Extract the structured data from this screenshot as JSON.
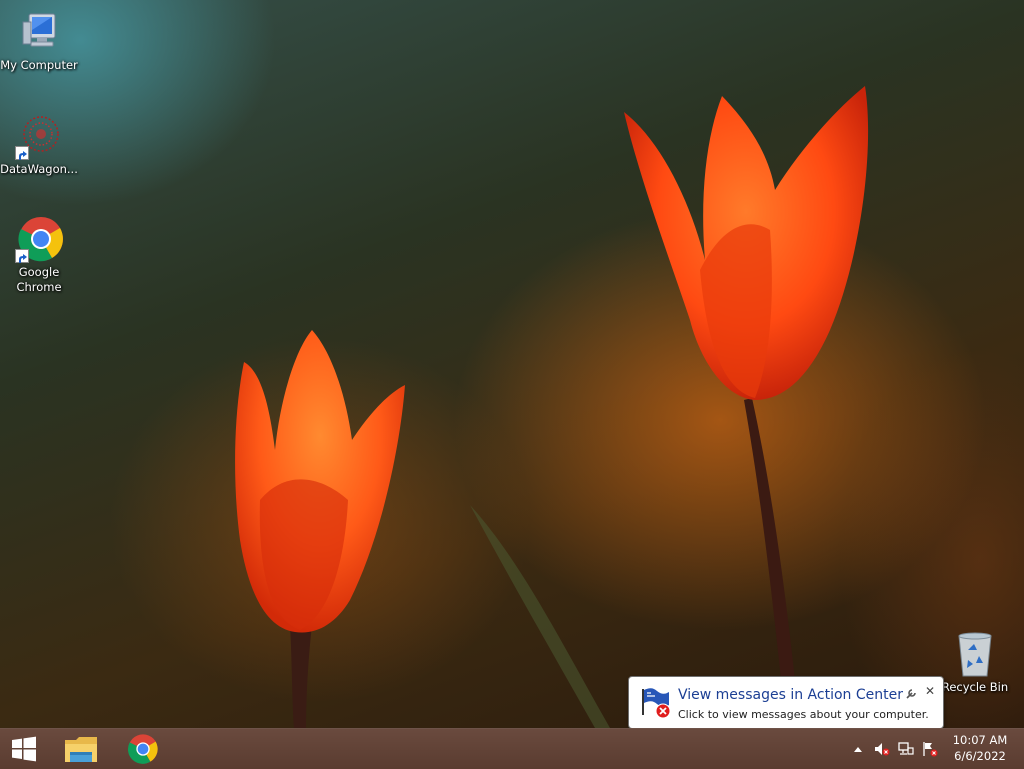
{
  "desktop": {
    "icons": [
      {
        "label": "My Computer",
        "icon": "computer-icon"
      },
      {
        "label": "DataWagon...",
        "icon": "datawagon-icon"
      },
      {
        "label": "Google Chrome",
        "icon": "chrome-icon"
      },
      {
        "label": "Recycle Bin",
        "icon": "recycle-bin-icon"
      }
    ]
  },
  "balloon": {
    "title": "View messages in Action Center",
    "text": "Click to view messages about your computer.",
    "close_glyph": "✕"
  },
  "taskbar": {
    "pinned": [
      {
        "icon": "windows-start-icon"
      },
      {
        "icon": "file-explorer-icon"
      },
      {
        "icon": "chrome-icon"
      }
    ],
    "tray": {
      "icons": [
        "show-hidden-icons-chevron",
        "volume-muted-icon",
        "network-icon",
        "action-center-flag-icon"
      ]
    },
    "clock": {
      "time": "10:07 AM",
      "date": "6/6/2022"
    }
  },
  "colors": {
    "taskbar": "#5e4035",
    "balloon_title": "#1c3f94",
    "tulip": "#ff4a12"
  }
}
